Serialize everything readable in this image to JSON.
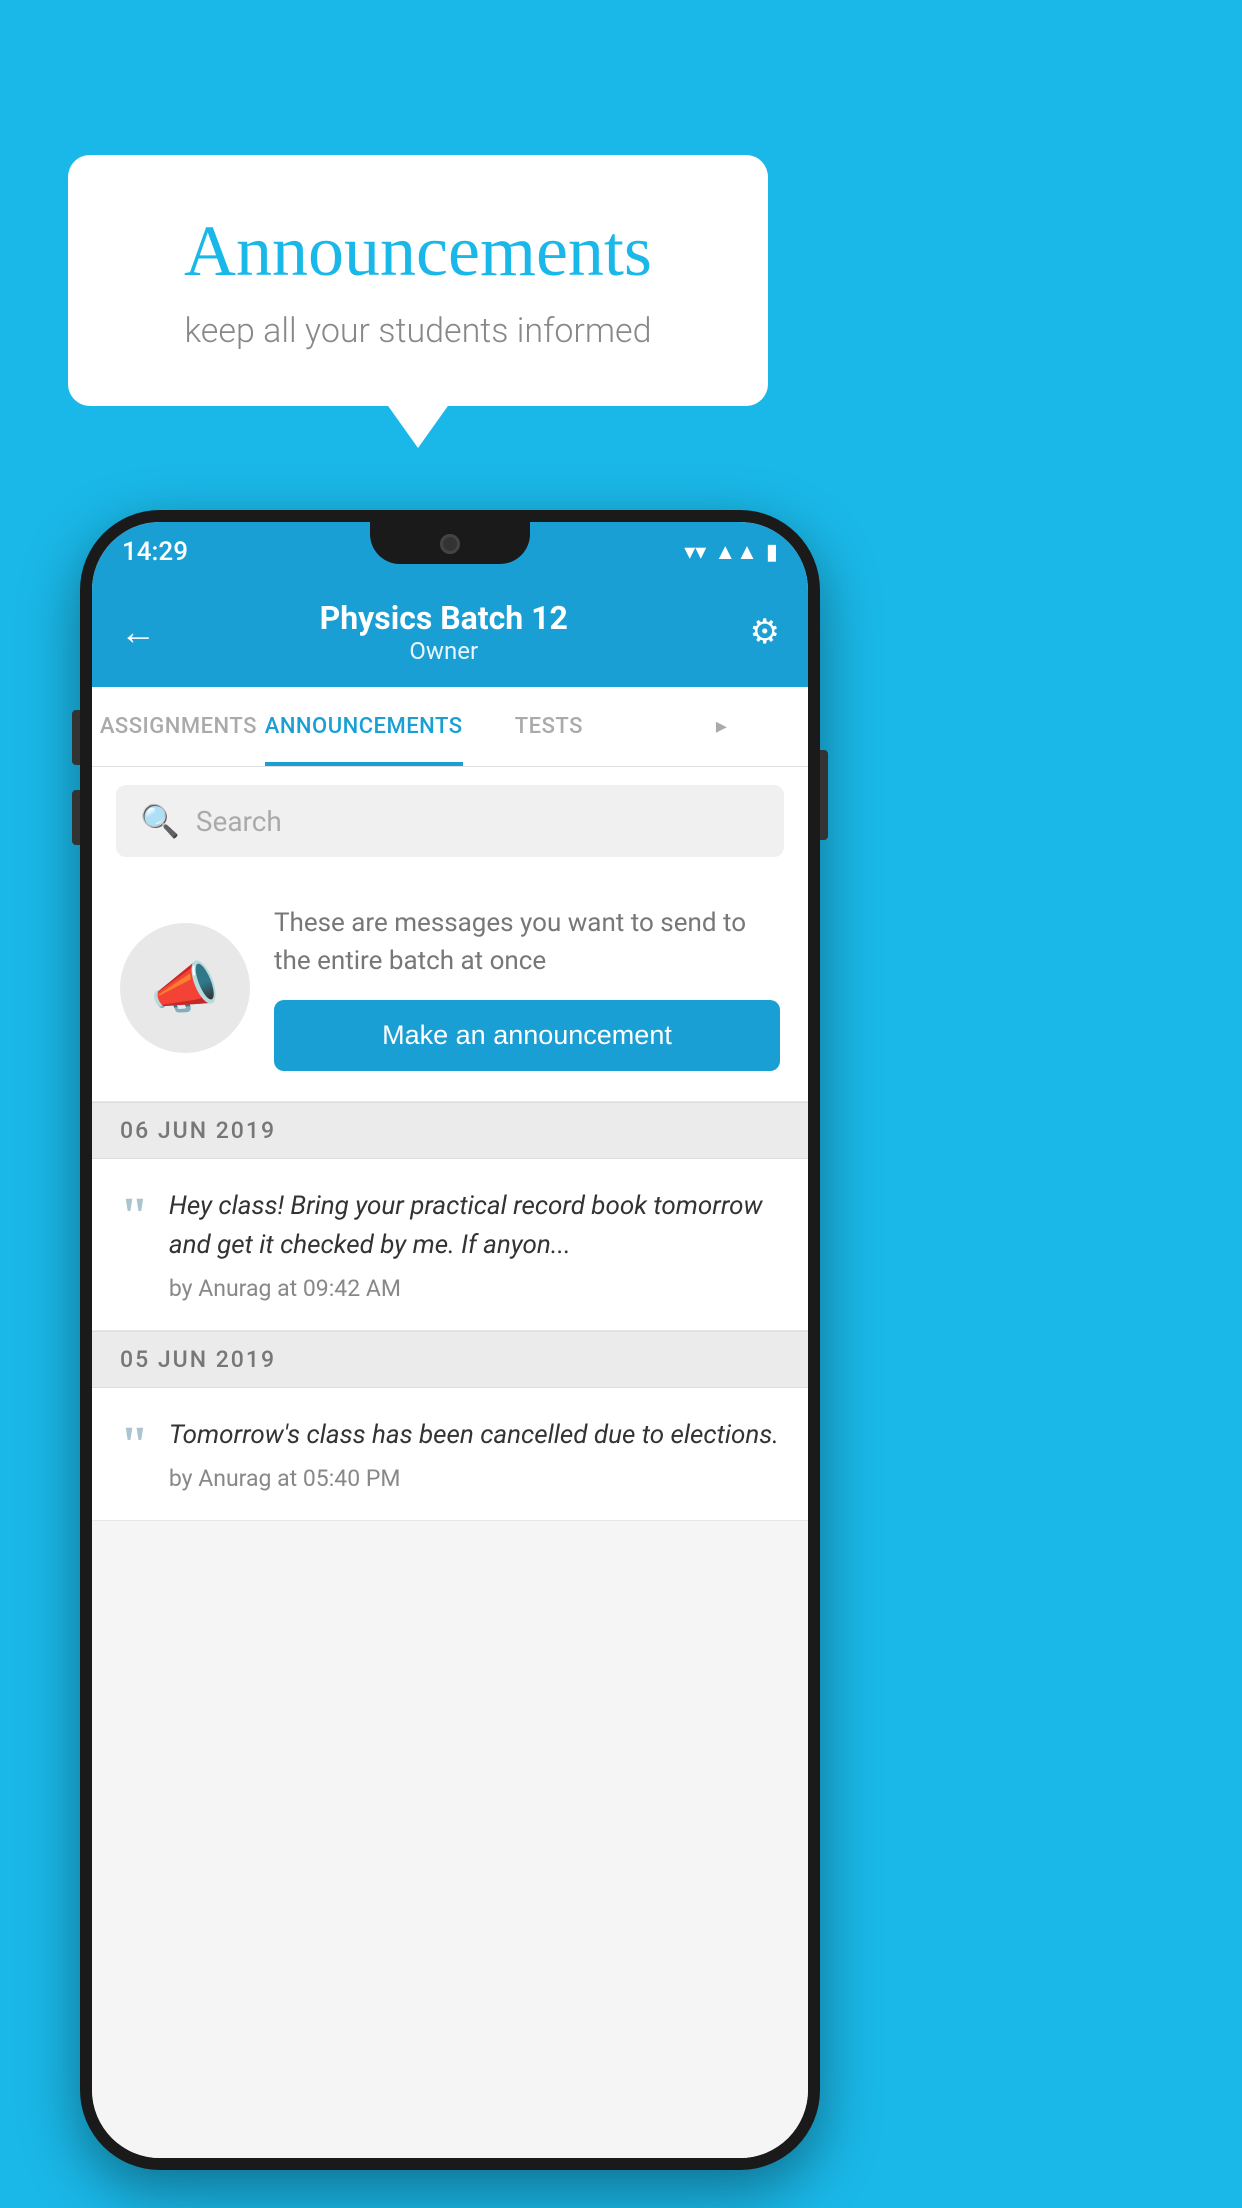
{
  "background_color": "#1ab8e8",
  "bubble": {
    "title": "Announcements",
    "subtitle": "keep all your students informed"
  },
  "phone": {
    "status_bar": {
      "time": "14:29",
      "icons": [
        "wifi",
        "signal",
        "battery"
      ]
    },
    "app_bar": {
      "title": "Physics Batch 12",
      "subtitle": "Owner",
      "back_label": "←",
      "settings_label": "⚙"
    },
    "tabs": [
      {
        "label": "ASSIGNMENTS",
        "active": false
      },
      {
        "label": "ANNOUNCEMENTS",
        "active": true
      },
      {
        "label": "TESTS",
        "active": false
      },
      {
        "label": "•",
        "active": false
      }
    ],
    "search": {
      "placeholder": "Search"
    },
    "announcement_intro": {
      "description": "These are messages you want to send to the entire batch at once",
      "cta_label": "Make an announcement"
    },
    "announcements": [
      {
        "date_separator": "06  JUN  2019",
        "message": "Hey class! Bring your practical record book tomorrow and get it checked by me. If anyon...",
        "author": "by Anurag at 09:42 AM"
      },
      {
        "date_separator": "05  JUN  2019",
        "message": "Tomorrow's class has been cancelled due to elections.",
        "author": "by Anurag at 05:40 PM"
      }
    ]
  }
}
